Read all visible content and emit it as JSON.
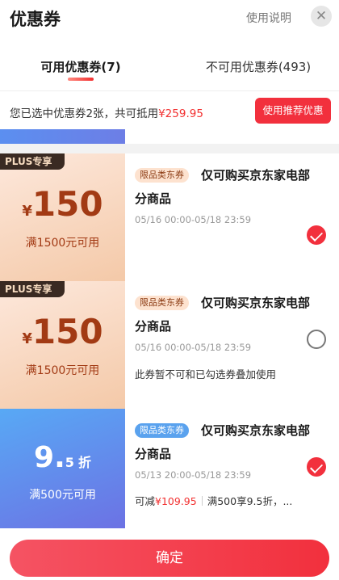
{
  "header": {
    "title": "优惠券",
    "help": "使用说明",
    "close_icon": "close-icon"
  },
  "tabs": [
    {
      "label": "可用优惠券(7)",
      "active": true
    },
    {
      "label": "不可用优惠券(493)",
      "active": false
    }
  ],
  "summary": {
    "text": "您已选中优惠券2张，共可抵用",
    "amount": "¥259.95",
    "button": "使用推荐优惠"
  },
  "coupons": [
    {
      "plus_tag": "PLUS专享",
      "currency": "¥",
      "amount": "150",
      "condition": "满1500元可用",
      "tag": "限品类东券",
      "title_line1": "仅可购买京东家电部",
      "title_line2": "分商品",
      "date": "05/16 00:00-05/18 23:59",
      "note": "",
      "selected": true
    },
    {
      "plus_tag": "PLUS专享",
      "currency": "¥",
      "amount": "150",
      "condition": "满1500元可用",
      "tag": "限品类东券",
      "title_line1": "仅可购买京东家电部",
      "title_line2": "分商品",
      "date": "05/16 00:00-05/18 23:59",
      "note": "此券暂不可和已勾选券叠加使用",
      "selected": false
    },
    {
      "discount": "9",
      "discount_dot": ".",
      "discount_decimal": "5",
      "discount_unit": "折",
      "condition": "满500元可用",
      "tag": "限品类东券",
      "title_line1": "仅可购买京东家电部",
      "title_line2": "分商品",
      "date": "05/13 20:00-05/18 23:59",
      "save_label": "可减",
      "save_amount": "¥109.95",
      "detail": "满500享9.5折，...",
      "selected": true
    }
  ],
  "footer": {
    "confirm": "确定"
  },
  "colors": {
    "accent": "#f2303d",
    "plus_card": "#f4c9a8",
    "blue_card": "#5aa2ee"
  }
}
